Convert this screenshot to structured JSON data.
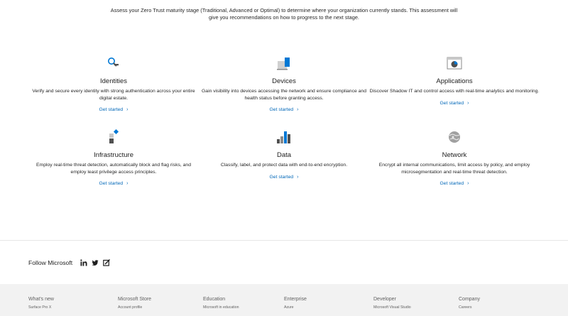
{
  "intro": {
    "text": "Assess your Zero Trust maturity stage (Traditional, Advanced or Optimal) to determine where your organization currently stands. This assessment will give you recommendations on how to progress to the next stage."
  },
  "cards": [
    {
      "title": "Identities",
      "desc": "Verify and secure every identity with strong authentication across your entire digital estate.",
      "cta": "Get started",
      "icon": "identity-search-icon"
    },
    {
      "title": "Devices",
      "desc": "Gain visibility into devices accessing the network and ensure compliance and health status before granting access.",
      "cta": "Get started",
      "icon": "devices-icon"
    },
    {
      "title": "Applications",
      "desc": "Discover Shadow IT and control access with real-time analytics and monitoring.",
      "cta": "Get started",
      "icon": "applications-icon"
    },
    {
      "title": "Infrastructure",
      "desc": "Employ real-time threat detection, automatically block and flag risks, and employ least privilege access principles.",
      "cta": "Get started",
      "icon": "infrastructure-icon"
    },
    {
      "title": "Data",
      "desc": "Classify, label, and protect data with end-to-end encryption.",
      "cta": "Get started",
      "icon": "data-chart-icon"
    },
    {
      "title": "Network",
      "desc": "Encrypt all internal communications, limit access by policy, and employ microsegmentation and real-time threat detection.",
      "cta": "Get started",
      "icon": "network-globe-icon"
    }
  ],
  "follow": {
    "label": "Follow Microsoft",
    "icons": [
      "linkedin-icon",
      "twitter-icon",
      "microsoft-blog-icon"
    ]
  },
  "footer": {
    "columns": [
      {
        "head": "What's new",
        "link": "Surface Pro X"
      },
      {
        "head": "Microsoft Store",
        "link": "Account profile"
      },
      {
        "head": "Education",
        "link": "Microsoft in education"
      },
      {
        "head": "Enterprise",
        "link": "Azure"
      },
      {
        "head": "Developer",
        "link": "Microsoft Visual Studio"
      },
      {
        "head": "Company",
        "link": "Careers"
      }
    ]
  },
  "colors": {
    "link": "#0067b8",
    "accent_blue": "#0078d4",
    "footer_bg": "#f2f2f2"
  }
}
